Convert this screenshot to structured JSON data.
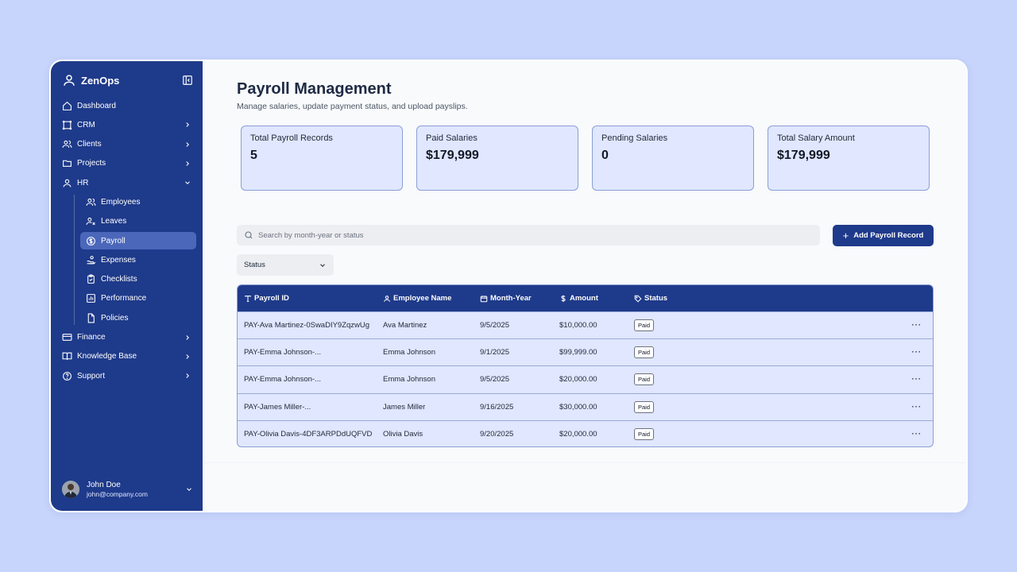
{
  "brand": {
    "name": "ZenOps"
  },
  "sidebar": {
    "items": [
      {
        "label": "Dashboard"
      },
      {
        "label": "CRM"
      },
      {
        "label": "Clients"
      },
      {
        "label": "Projects"
      },
      {
        "label": "HR"
      },
      {
        "label": "Finance"
      },
      {
        "label": "Knowledge Base"
      },
      {
        "label": "Support"
      }
    ],
    "hr_sub": [
      {
        "label": "Employees"
      },
      {
        "label": "Leaves"
      },
      {
        "label": "Payroll"
      },
      {
        "label": "Expenses"
      },
      {
        "label": "Checklists"
      },
      {
        "label": "Performance"
      },
      {
        "label": "Policies"
      }
    ]
  },
  "user": {
    "name": "John Doe",
    "email": "john@company.com"
  },
  "page": {
    "title": "Payroll Management",
    "subtitle": "Manage salaries, update payment status, and upload payslips."
  },
  "stats": [
    {
      "label": "Total Payroll Records",
      "value": "5"
    },
    {
      "label": "Paid Salaries",
      "value": "$179,999"
    },
    {
      "label": "Pending Salaries",
      "value": "0"
    },
    {
      "label": "Total Salary Amount",
      "value": "$179,999"
    }
  ],
  "search": {
    "placeholder": "Search by month-year or status"
  },
  "add_button": {
    "label": "Add Payroll Record"
  },
  "status_filter": {
    "label": "Status"
  },
  "table": {
    "headers": [
      "Payroll ID",
      "Employee Name",
      "Month-Year",
      "Amount",
      "Status"
    ],
    "rows": [
      {
        "id": "PAY-Ava Martinez-0SwaDIY9ZqzwUg",
        "name": "Ava Martinez",
        "month": "9/5/2025",
        "amount": "$10,000.00",
        "status": "Paid"
      },
      {
        "id": "PAY-Emma Johnson-...",
        "name": "Emma Johnson",
        "month": "9/1/2025",
        "amount": "$99,999.00",
        "status": "Paid"
      },
      {
        "id": "PAY-Emma Johnson-...",
        "name": "Emma Johnson",
        "month": "9/5/2025",
        "amount": "$20,000.00",
        "status": "Paid"
      },
      {
        "id": "PAY-James Miller-...",
        "name": "James Miller",
        "month": "9/16/2025",
        "amount": "$30,000.00",
        "status": "Paid"
      },
      {
        "id": "PAY-Olivia Davis-4DF3ARPDdUQFVD",
        "name": "Olivia Davis",
        "month": "9/20/2025",
        "amount": "$20,000.00",
        "status": "Paid"
      }
    ],
    "row_action": "···"
  },
  "colors": {
    "primary": "#1e3a8a",
    "card": "#e0e7ff",
    "background": "#c7d4fb",
    "active": "#4b67ba"
  }
}
